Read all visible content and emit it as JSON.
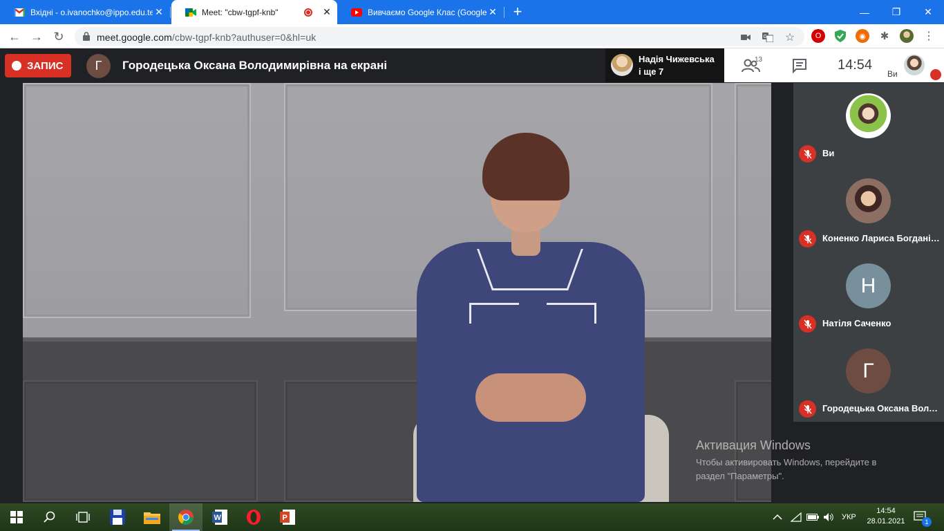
{
  "browser": {
    "tabs": [
      {
        "title": "Вхідні - o.ivanochko@ippo.edu.te",
        "icon": "gmail-icon"
      },
      {
        "title": "Meet: \"cbw-tgpf-knb\"",
        "icon": "meet-icon"
      },
      {
        "title": "Вивчаємо Google Клас (Google",
        "icon": "youtube-icon"
      }
    ],
    "new_tab": "+",
    "window_controls": {
      "minimize": "—",
      "restore": "❐",
      "close": "✕"
    },
    "url_host": "meet.google.com",
    "url_path": "/cbw-tgpf-knb?authuser=0&hl=uk"
  },
  "meet": {
    "record_label": "ЗАПИС",
    "presenter_initial": "Г",
    "presenting_title": "Городецька Оксана Володимирівна на екрані",
    "speaker_name": "Надія Чижевська",
    "speaker_more": "і ще 7",
    "participants_count": "13",
    "clock": "14:54",
    "self_label": "Ви",
    "accent": "#1a73e8",
    "mute_color": "#d93025"
  },
  "participants": [
    {
      "name": "Ви",
      "initial": "",
      "avatar_color": "#8bc34a"
    },
    {
      "name": "Коненко Лариса Богданівна",
      "initial": "",
      "avatar_color": "#8d6e63"
    },
    {
      "name": "Натіля Саченко",
      "initial": "Н",
      "avatar_color": "#78909c"
    },
    {
      "name": "Городецька Оксана Володимирівна",
      "initial": "Г",
      "avatar_color": "#6d4c41"
    }
  ],
  "activation": {
    "title": "Активация Windows",
    "line1": "Чтобы активировать Windows, перейдите в",
    "line2": "раздел \"Параметры\"."
  },
  "taskbar": {
    "lang": "УКР",
    "time": "14:54",
    "date": "28.01.2021",
    "notifications": "1"
  }
}
